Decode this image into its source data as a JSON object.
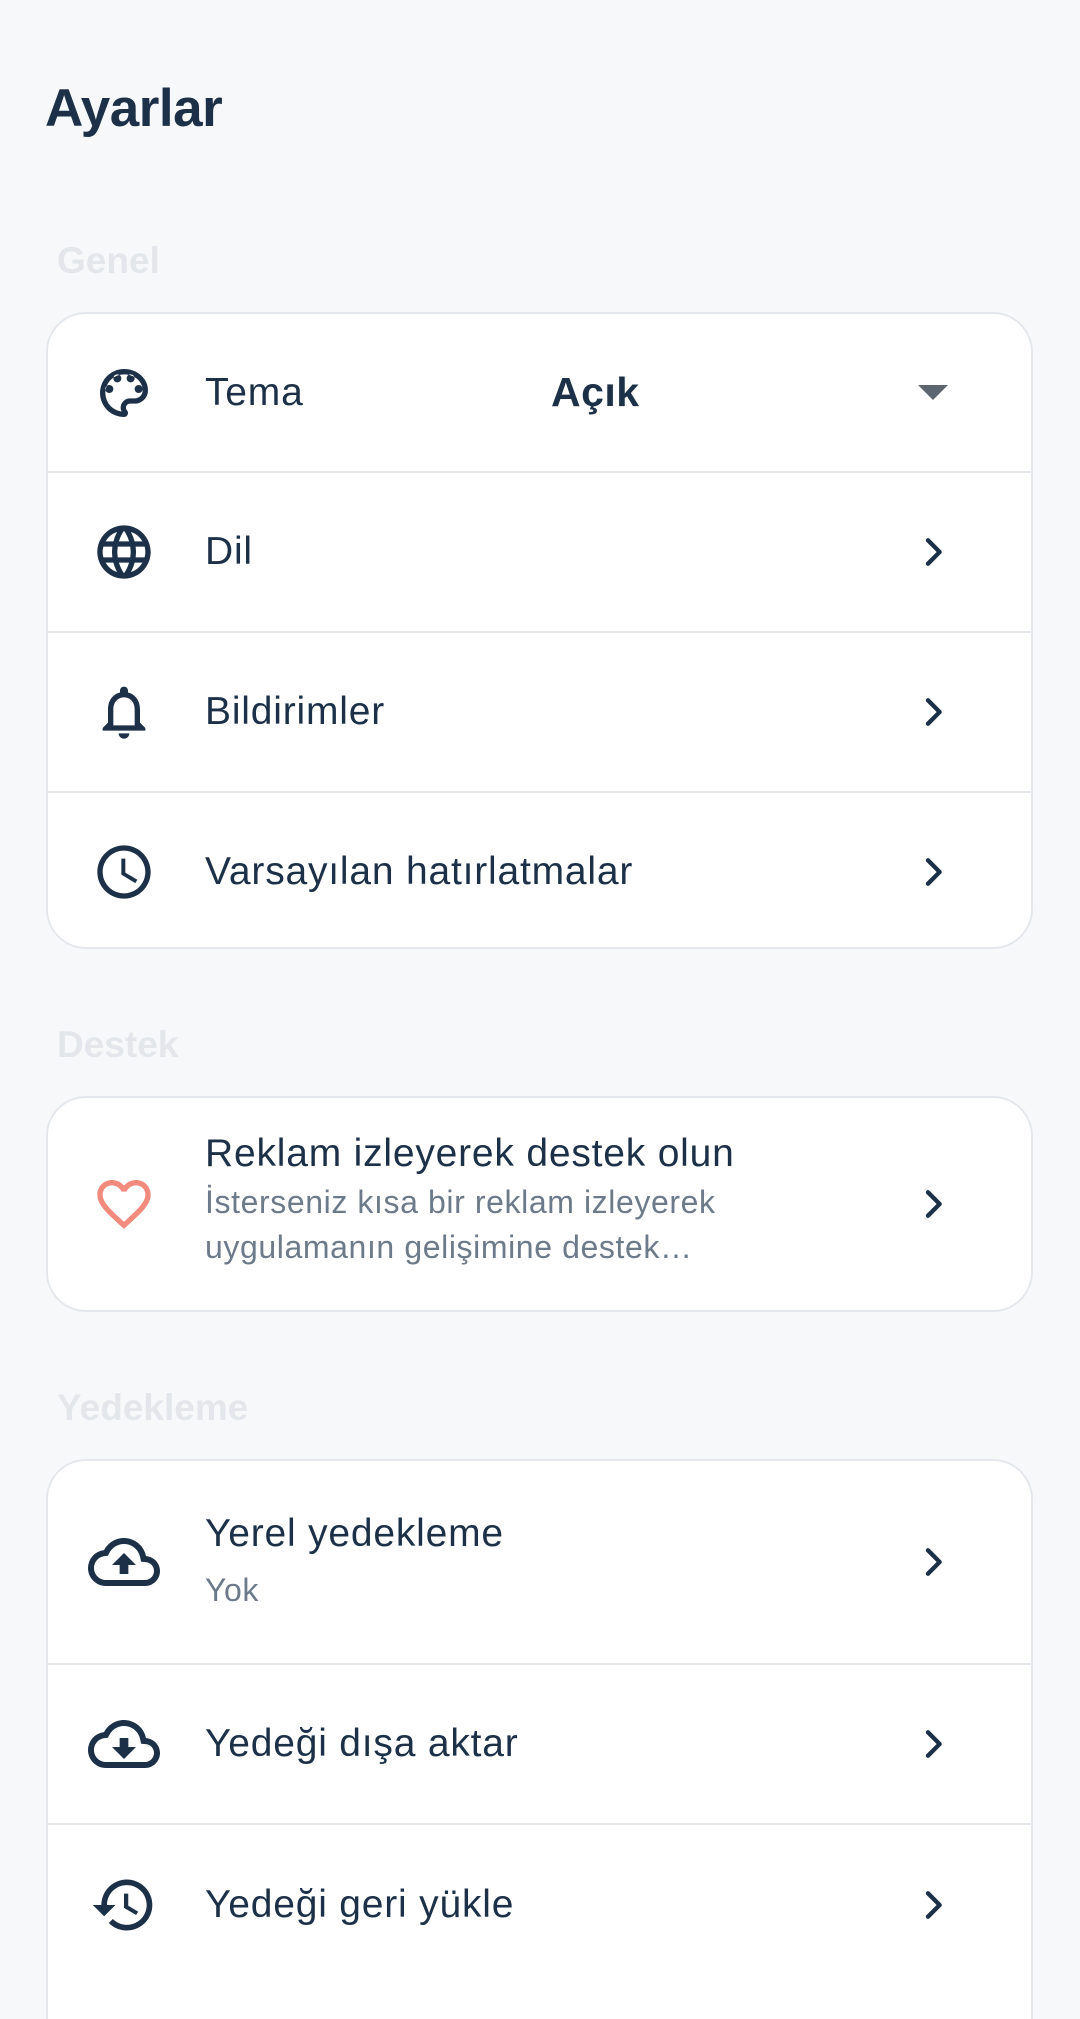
{
  "page": {
    "title": "Ayarlar"
  },
  "sections": {
    "general": {
      "title": "Genel",
      "theme": {
        "label": "Tema",
        "value": "Açık",
        "icon": "palette-icon"
      },
      "language": {
        "label": "Dil",
        "icon": "globe-icon"
      },
      "notifications": {
        "label": "Bildirimler",
        "icon": "bell-icon"
      },
      "reminders": {
        "label": "Varsayılan hatırlatmalar",
        "icon": "clock-icon"
      }
    },
    "support": {
      "title": "Destek",
      "ads": {
        "label": "Reklam izleyerek destek olun",
        "description": "İsterseniz kısa bir reklam izleyerek uygulamanın gelişimine destek olabilirsiniz.",
        "icon": "heart-icon"
      }
    },
    "backup": {
      "title": "Yedekleme",
      "local": {
        "label": "Yerel yedekleme",
        "value": "Yok",
        "icon": "cloud-upload-icon"
      },
      "export": {
        "label": "Yedeği dışa aktar",
        "icon": "cloud-download-icon"
      },
      "restore": {
        "label": "Yedeği geri yükle",
        "icon": "restore-history-icon"
      }
    }
  },
  "colors": {
    "primary_text": "#1c3148",
    "secondary_text": "#6c7a89",
    "section_label": "#e3e7ec",
    "background": "#f6f8fa",
    "card": "#ffffff",
    "divider": "#e4e7eb",
    "heart": "#f28a7e"
  }
}
